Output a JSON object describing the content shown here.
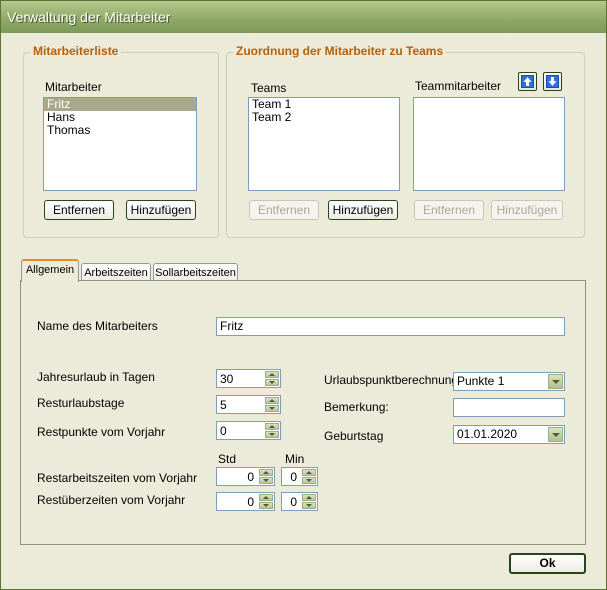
{
  "window": {
    "title": "Verwaltung der Mitarbeiter"
  },
  "employee_group": {
    "title": "Mitarbeiterliste",
    "list_label": "Mitarbeiter",
    "employees": [
      "Fritz",
      "Hans",
      "Thomas"
    ],
    "selected": "Fritz",
    "remove_label": "Entfernen",
    "add_label": "Hinzufügen"
  },
  "teams_group": {
    "title": "Zuordnung der Mitarbeiter zu Teams",
    "teams_label": "Teams",
    "teams": [
      "Team 1",
      "Team 2"
    ],
    "members_label": "Teammitarbeiter",
    "members": [],
    "teams_remove_label": "Entfernen",
    "teams_add_label": "Hinzufügen",
    "members_remove_label": "Entfernen",
    "members_add_label": "Hinzufügen",
    "move_up_icon": "arrow-up-icon",
    "move_down_icon": "arrow-down-icon"
  },
  "tabs": [
    {
      "label": "Allgemein",
      "active": true
    },
    {
      "label": "Arbeitszeiten",
      "active": false
    },
    {
      "label": "Sollarbeitszeiten",
      "active": false
    }
  ],
  "general": {
    "name_label": "Name des Mitarbeiters",
    "name_value": "Fritz",
    "vacation_days_label": "Jahresurlaub in Tagen",
    "vacation_days_value": "30",
    "remaining_vacation_label": "Resturlaubstage",
    "remaining_vacation_value": "5",
    "remaining_points_label": "Restpunkte vom Vorjahr",
    "remaining_points_value": "0",
    "vacation_points_label": "Urlaubspunktberechnung",
    "vacation_points_value": "Punkte 1",
    "remark_label": "Bemerkung:",
    "remark_value": "",
    "birthday_label": "Geburtstag",
    "birthday_value": "01.01.2020",
    "hours_header": "Std",
    "minutes_header": "Min",
    "remaining_worktime_label": "Restarbeitszeiten vom Vorjahr",
    "remaining_worktime_hours": "0",
    "remaining_worktime_minutes": "0",
    "remaining_overtime_label": "Restüberzeiten vom Vorjahr",
    "remaining_overtime_hours": "0",
    "remaining_overtime_minutes": "0"
  },
  "footer": {
    "ok_label": "Ok"
  }
}
